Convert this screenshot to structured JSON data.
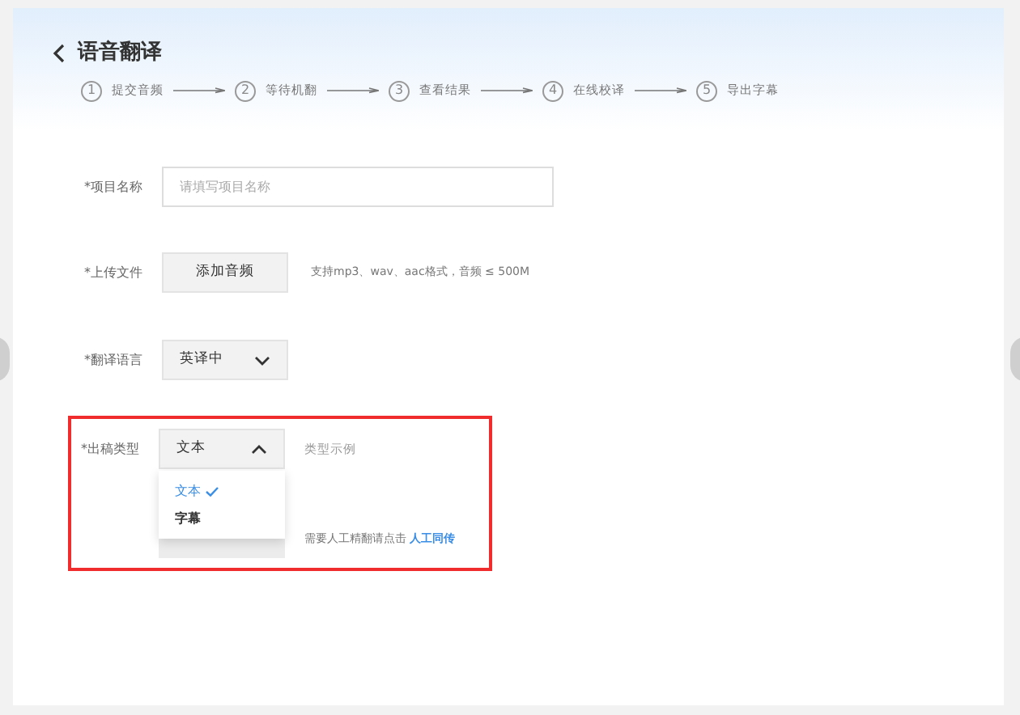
{
  "header": {
    "title": "语音翻译",
    "steps": [
      {
        "number": "1",
        "label": "提交音频"
      },
      {
        "number": "2",
        "label": "等待机翻"
      },
      {
        "number": "3",
        "label": "查看结果"
      },
      {
        "number": "4",
        "label": "在线校译"
      },
      {
        "number": "5",
        "label": "导出字幕"
      }
    ]
  },
  "form": {
    "project_name": {
      "label": "*项目名称",
      "placeholder": "请填写项目名称"
    },
    "upload": {
      "label": "*上传文件",
      "button": "添加音频",
      "hint": "支持mp3、wav、aac格式，音频 ≤ 500M"
    },
    "language": {
      "label": "*翻译语言",
      "value": "英译中",
      "expanded": false
    },
    "output_type": {
      "label": "*出稿类型",
      "value": "文本",
      "expanded": true,
      "example": "类型示例",
      "options": [
        {
          "label": "文本",
          "selected": true
        },
        {
          "label": "字幕",
          "selected": false
        }
      ]
    },
    "submit": {
      "hint": "需要人工精翻请点击",
      "link": "人工同传"
    }
  }
}
